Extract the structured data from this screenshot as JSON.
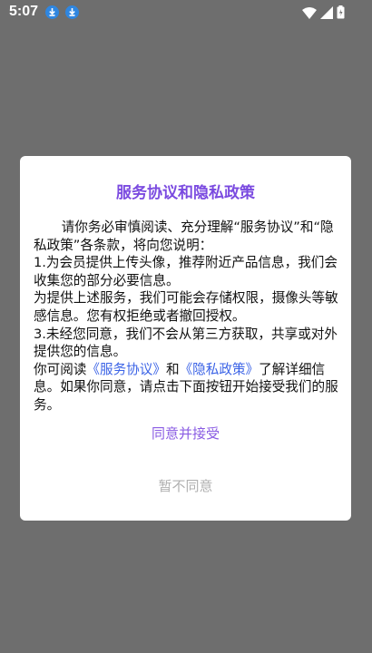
{
  "status_bar": {
    "time": "5:07",
    "icons": [
      "download-icon",
      "download-icon",
      "wifi-icon",
      "signal-icon",
      "battery-icon"
    ]
  },
  "dialog": {
    "title": "服务协议和隐私政策",
    "intro": "请你务必审慎阅读、充分理解“服务协议”和“隐私政策”各条款，将向您说明：",
    "item1": "1.为会员提供上传头像，推荐附近产品信息，我们会收集您的部分必要信息。",
    "item2": "为提供上述服务，我们可能会存储权限，摄像头等敏感信息。您有权拒绝或者撤回授权。",
    "item3": "3.未经您同意，我们不会从第三方获取，共享或对外提供您的信息。",
    "closing": {
      "prefix": "你可阅读",
      "service_link": "《服务协议》",
      "and": "和",
      "privacy_link": "《隐私政策》",
      "suffix": "了解详细信息。如果你同意，请点击下面按钮开始接受我们的服务。"
    },
    "accept_label": "同意并接受",
    "decline_label": "暂不同意"
  },
  "colors": {
    "title": "#7b4be0",
    "link": "#3b63e6",
    "accept": "#8a5ce3",
    "decline": "#b0b0b0",
    "overlay": "#6e6e6e"
  }
}
